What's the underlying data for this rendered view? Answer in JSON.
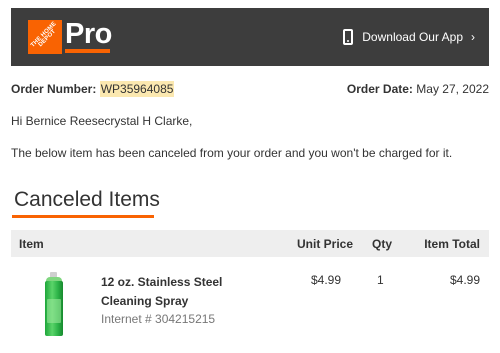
{
  "header": {
    "logo_text": "THE HOME DEPOT",
    "brand": "Pro",
    "app_link": "Download Our App",
    "app_chevron": "›"
  },
  "order": {
    "number_label": "Order Number:",
    "number": "WP35964085",
    "date_label": "Order Date:",
    "date": "May 27, 2022"
  },
  "greeting": "Hi Bernice Reesecrystal H Clarke,",
  "message": "The below item has been canceled from your order and you won't be charged for it.",
  "section_title": "Canceled Items",
  "table": {
    "headers": {
      "item": "Item",
      "unit_price": "Unit Price",
      "qty": "Qty",
      "item_total": "Item Total"
    },
    "rows": [
      {
        "name": "12 oz. Stainless Steel Cleaning Spray",
        "internet": "Internet # 304215215",
        "unit_price": "$4.99",
        "qty": "1",
        "item_total": "$4.99",
        "image_icon": "green-spray-can-icon"
      }
    ]
  },
  "colors": {
    "header_bg": "#3d3d3d",
    "brand_orange": "#f96302",
    "order_highlight": "#fbe8b0",
    "table_head_bg": "#eeeeee"
  }
}
